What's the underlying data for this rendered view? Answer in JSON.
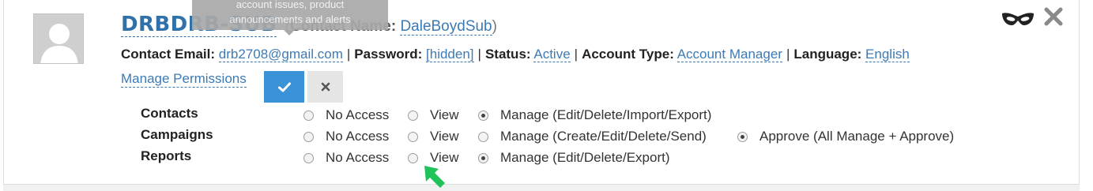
{
  "tooltip": {
    "line1": "account issues, product",
    "line2": "announcements and alerts"
  },
  "account": {
    "title": "DRBDRB-SUB",
    "contact_name_prefix": "(",
    "contact_name_label": "Contact Name:",
    "contact_name_value": "DaleBoydSub",
    "contact_name_suffix": ")"
  },
  "info": {
    "email_label": "Contact Email:",
    "email_value": "drb2708@gmail.com",
    "password_label": "Password:",
    "password_value": "[hidden]",
    "status_label": "Status:",
    "status_value": "Active",
    "account_type_label": "Account Type:",
    "account_type_value": "Account Manager",
    "language_label": "Language:",
    "language_value": "English",
    "separator": "|"
  },
  "manage_permissions_label": "Manage Permissions",
  "permissions": [
    {
      "label": "Contacts",
      "options": [
        {
          "label": "No Access",
          "checked": false
        },
        {
          "label": "View",
          "checked": false
        },
        {
          "label": "Manage (Edit/Delete/Import/Export)",
          "checked": true
        }
      ]
    },
    {
      "label": "Campaigns",
      "options": [
        {
          "label": "No Access",
          "checked": false
        },
        {
          "label": "View",
          "checked": false
        },
        {
          "label": "Manage (Create/Edit/Delete/Send)",
          "checked": false
        },
        {
          "label": "Approve (All Manage + Approve)",
          "checked": true
        }
      ]
    },
    {
      "label": "Reports",
      "options": [
        {
          "label": "No Access",
          "checked": false
        },
        {
          "label": "View",
          "checked": false
        },
        {
          "label": "Manage (Edit/Delete/Export)",
          "checked": true
        }
      ]
    }
  ],
  "icons": {
    "avatar": "default-user-avatar",
    "confirm": "checkmark-icon",
    "cancel": "x-icon",
    "impersonate": "mask-icon",
    "close": "close-icon",
    "pointer": "green-cursor-arrow"
  },
  "colors": {
    "link": "#3c7ab5",
    "title": "#3071a9",
    "confirm_button": "#3a93d6",
    "cancel_button": "#e5e5e5",
    "cursor": "#1fc35a"
  }
}
